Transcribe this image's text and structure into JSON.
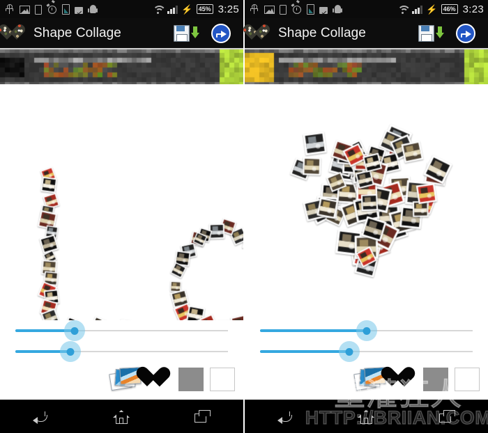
{
  "panels": [
    {
      "id": "left",
      "status_bar": {
        "icons": [
          "usb-icon",
          "picture-icon",
          "phone-icon",
          "alarm-icon",
          "sd-card-icon",
          "bag-check-icon",
          "android-icon"
        ],
        "wifi_icon": "wifi-icon",
        "signal_icon": "signal-bars-icon",
        "charging_icon": "bolt-icon",
        "battery": "45%",
        "time": "3:25"
      },
      "app_bar": {
        "logo": "heart-collage-logo",
        "title": "Shape Collage",
        "save_icon": "save-floppy-icon",
        "share_icon": "share-arrow-icon"
      },
      "banner": {
        "label": "advertisement-banner-blurred",
        "accent": "#b5cc2e"
      },
      "collage": {
        "shape": "text-love",
        "text": "Love",
        "tile_count": 95
      },
      "sliders": [
        {
          "name": "photo-size-slider",
          "value": 28
        },
        {
          "name": "photo-count-slider",
          "value": 26
        }
      ],
      "swatches": [
        {
          "name": "photos-source-swatch",
          "kind": "photos",
          "selected": false
        },
        {
          "name": "shape-heart-swatch",
          "kind": "heart",
          "color": "#050505",
          "selected": false
        },
        {
          "name": "background-gray-swatch",
          "kind": "color",
          "color": "#8c8c8c",
          "selected": false
        },
        {
          "name": "background-white-swatch",
          "kind": "color",
          "color": "#ffffff",
          "selected": true
        }
      ],
      "nav_bar": {
        "back": "back-icon",
        "home": "home-icon",
        "recents": "recents-icon"
      },
      "watermark": null
    },
    {
      "id": "right",
      "status_bar": {
        "icons": [
          "usb-icon",
          "picture-icon",
          "phone-icon",
          "alarm-icon",
          "sd-card-icon",
          "bag-check-icon",
          "android-icon"
        ],
        "wifi_icon": "wifi-icon",
        "signal_icon": "signal-bars-icon",
        "charging_icon": "bolt-icon",
        "battery": "46%",
        "time": "3:23"
      },
      "app_bar": {
        "logo": "heart-collage-logo",
        "title": "Shape Collage",
        "save_icon": "save-floppy-icon",
        "share_icon": "share-arrow-icon"
      },
      "banner": {
        "label": "advertisement-banner-blurred",
        "accent": "#b5cc2e"
      },
      "collage": {
        "shape": "heart",
        "text": "",
        "tile_count": 78
      },
      "sliders": [
        {
          "name": "photo-size-slider",
          "value": 50
        },
        {
          "name": "photo-count-slider",
          "value": 42
        }
      ],
      "swatches": [
        {
          "name": "photos-source-swatch",
          "kind": "photos",
          "selected": false
        },
        {
          "name": "shape-heart-swatch",
          "kind": "heart",
          "color": "#050505",
          "selected": false
        },
        {
          "name": "background-gray-swatch",
          "kind": "color",
          "color": "#8c8c8c",
          "selected": false
        },
        {
          "name": "background-white-swatch",
          "kind": "color",
          "color": "#ffffff",
          "selected": true
        }
      ],
      "nav_bar": {
        "back": "back-icon",
        "home": "home-icon",
        "recents": "recents-icon"
      },
      "watermark": {
        "cjk": "重灌狂人",
        "url": "HTTP://BRIIAN.COM"
      }
    }
  ]
}
